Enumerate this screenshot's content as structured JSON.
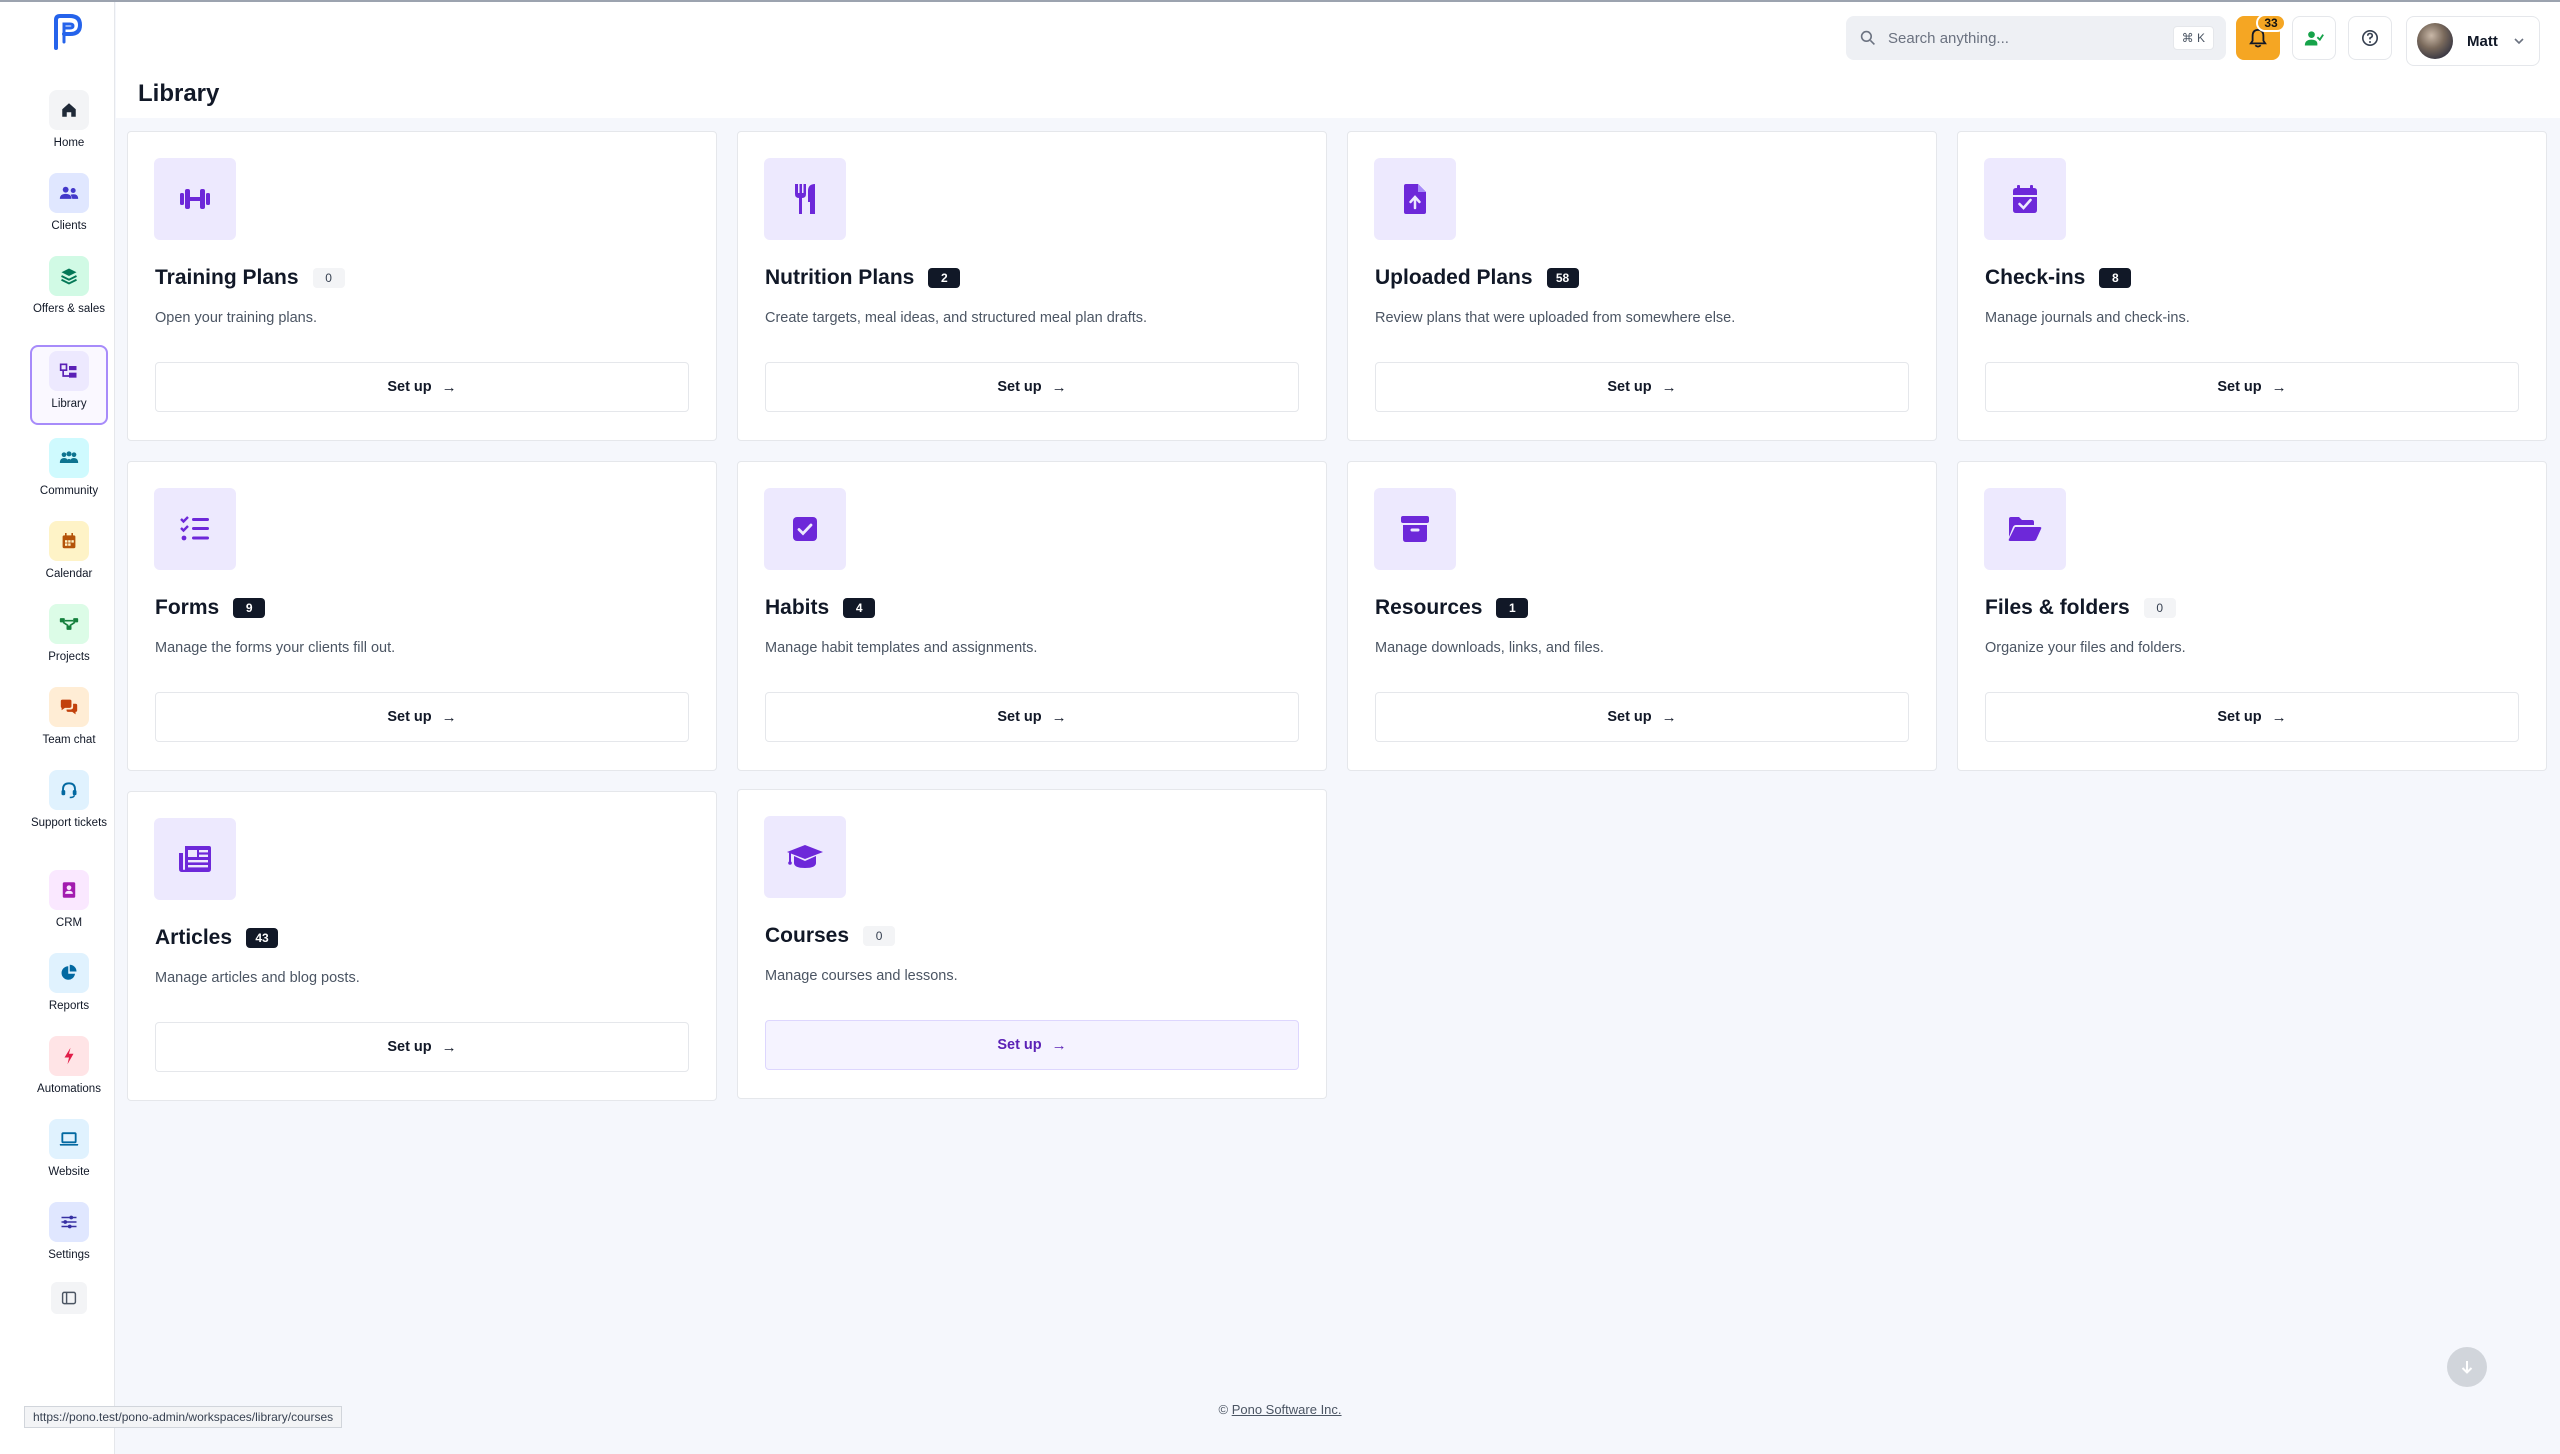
{
  "sidebar": {
    "items": [
      {
        "label": "Home",
        "icon": "home-icon",
        "bg": "#f3f4f6"
      },
      {
        "label": "Clients",
        "icon": "users-icon",
        "bg": "#e0e7ff"
      },
      {
        "label": "Offers & sales",
        "icon": "layers-icon",
        "bg": "#d1fae5"
      },
      {
        "label": "Library",
        "icon": "library-icon",
        "bg": "#ede9fe"
      },
      {
        "label": "Community",
        "icon": "community-icon",
        "bg": "#cffafe"
      },
      {
        "label": "Calendar",
        "icon": "calendar-icon",
        "bg": "#fef3c7"
      },
      {
        "label": "Projects",
        "icon": "projects-icon",
        "bg": "#dcfce7"
      },
      {
        "label": "Team chat",
        "icon": "chat-icon",
        "bg": "#ffedd5"
      },
      {
        "label": "Support tickets",
        "icon": "headset-icon",
        "bg": "#e0f2fe"
      },
      {
        "label": "CRM",
        "icon": "crm-icon",
        "bg": "#fae8ff"
      },
      {
        "label": "Reports",
        "icon": "pie-chart-icon",
        "bg": "#e0f2fe"
      },
      {
        "label": "Automations",
        "icon": "bolt-icon",
        "bg": "#ffe4e6"
      },
      {
        "label": "Website",
        "icon": "laptop-icon",
        "bg": "#e0f2fe"
      },
      {
        "label": "Settings",
        "icon": "sliders-icon",
        "bg": "#e0e7ff"
      }
    ]
  },
  "header": {
    "search_placeholder": "Search anything...",
    "search_shortcut": "⌘ K",
    "notifications_count": "33",
    "user_name": "Matt"
  },
  "page": {
    "title": "Library"
  },
  "cards": [
    {
      "title": "Training Plans",
      "count": "0",
      "desc": "Open your training plans.",
      "action": "Set up",
      "icon": "dumbbell-icon"
    },
    {
      "title": "Nutrition Plans",
      "count": "2",
      "desc": "Create targets, meal ideas, and structured meal plan drafts.",
      "action": "Set up",
      "icon": "utensils-icon"
    },
    {
      "title": "Uploaded Plans",
      "count": "58",
      "desc": "Review plans that were uploaded from somewhere else.",
      "action": "Set up",
      "icon": "file-upload-icon"
    },
    {
      "title": "Check-ins",
      "count": "8",
      "desc": "Manage journals and check-ins.",
      "action": "Set up",
      "icon": "calendar-check-icon"
    },
    {
      "title": "Forms",
      "count": "9",
      "desc": "Manage the forms your clients fill out.",
      "action": "Set up",
      "icon": "list-check-icon"
    },
    {
      "title": "Habits",
      "count": "4",
      "desc": "Manage habit templates and assignments.",
      "action": "Set up",
      "icon": "checkbox-icon"
    },
    {
      "title": "Resources",
      "count": "1",
      "desc": "Manage downloads, links, and files.",
      "action": "Set up",
      "icon": "archive-icon"
    },
    {
      "title": "Files & folders",
      "count": "0",
      "desc": "Organize your files and folders.",
      "action": "Set up",
      "icon": "folder-open-icon"
    },
    {
      "title": "Articles",
      "count": "43",
      "desc": "Manage articles and blog posts.",
      "action": "Set up",
      "icon": "newspaper-icon"
    },
    {
      "title": "Courses",
      "count": "0",
      "desc": "Manage courses and lessons.",
      "action": "Set up",
      "icon": "graduation-cap-icon"
    }
  ],
  "footer": {
    "copyright": "©",
    "company": "Pono Software Inc."
  },
  "status_url": "https://pono.test/pono-admin/workspaces/library/courses",
  "colors": {
    "accent": "#6d28d9",
    "icon_bg": "#ede9fe",
    "bell": "#f5a623"
  }
}
